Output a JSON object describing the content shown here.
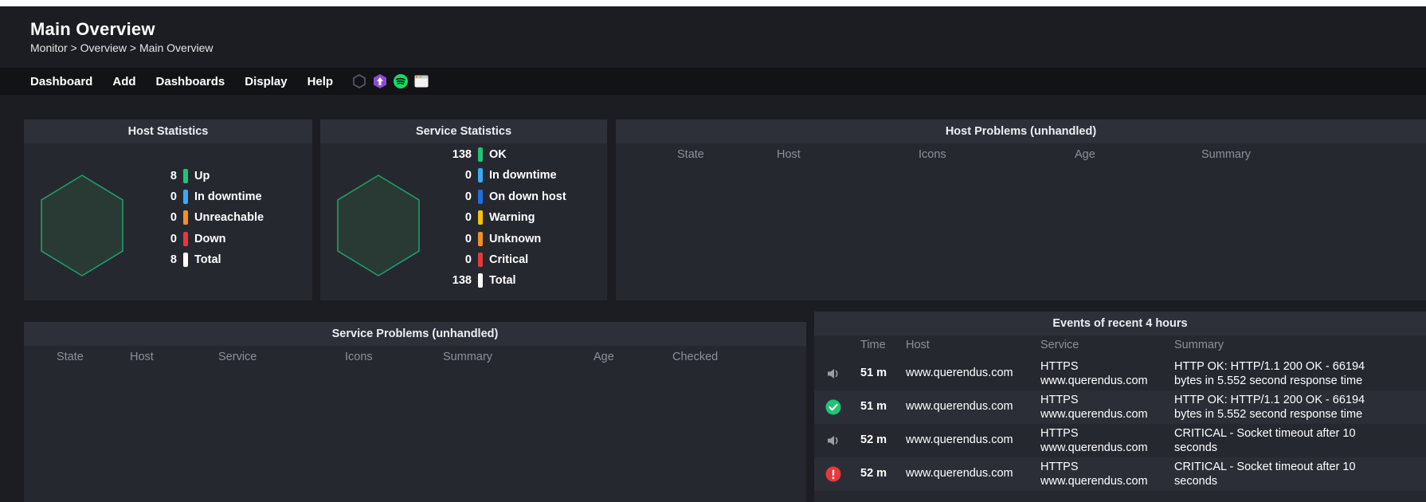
{
  "header": {
    "title": "Main Overview",
    "breadcrumb": "Monitor > Overview > Main Overview"
  },
  "menu": {
    "items": [
      "Dashboard",
      "Add",
      "Dashboards",
      "Display",
      "Help"
    ],
    "icons": [
      "hexagon-outline-icon",
      "upload-badge-icon",
      "spotify-icon",
      "window-icon"
    ]
  },
  "host_statistics": {
    "title": "Host Statistics",
    "rows": [
      {
        "count": "8",
        "label": "Up",
        "color": "#22c277"
      },
      {
        "count": "0",
        "label": "In downtime",
        "color": "#3aa9f4"
      },
      {
        "count": "0",
        "label": "Unreachable",
        "color": "#f0902a"
      },
      {
        "count": "0",
        "label": "Down",
        "color": "#e5393b"
      },
      {
        "count": "8",
        "label": "Total",
        "color": "#ffffff"
      }
    ]
  },
  "service_statistics": {
    "title": "Service Statistics",
    "rows": [
      {
        "count": "138",
        "label": "OK",
        "color": "#22c277"
      },
      {
        "count": "0",
        "label": "In downtime",
        "color": "#3aa9f4"
      },
      {
        "count": "0",
        "label": "On down host",
        "color": "#1e6fe0"
      },
      {
        "count": "0",
        "label": "Warning",
        "color": "#f4c20d"
      },
      {
        "count": "0",
        "label": "Unknown",
        "color": "#f0902a"
      },
      {
        "count": "0",
        "label": "Critical",
        "color": "#e5393b"
      },
      {
        "count": "138",
        "label": "Total",
        "color": "#ffffff"
      }
    ]
  },
  "host_problems": {
    "title": "Host Problems (unhandled)",
    "columns": [
      "State",
      "Host",
      "Icons",
      "Age",
      "Summary"
    ]
  },
  "service_problems": {
    "title": "Service Problems (unhandled)",
    "columns": [
      "State",
      "Host",
      "Service",
      "Icons",
      "Summary",
      "Age",
      "Checked"
    ]
  },
  "events": {
    "title": "Events of recent 4 hours",
    "columns": [
      "Time",
      "Host",
      "Service",
      "Summary"
    ],
    "rows": [
      {
        "icon": "speaker-icon",
        "time": "51 m",
        "host": "www.querendus.com",
        "service_1": "HTTPS",
        "service_2": "www.querendus.com",
        "summary_1": "HTTP OK: HTTP/1.1 200 OK - 66194",
        "summary_2": "bytes in 5.552 second response time"
      },
      {
        "icon": "ok-check-icon",
        "time": "51 m",
        "host": "www.querendus.com",
        "service_1": "HTTPS",
        "service_2": "www.querendus.com",
        "summary_1": "HTTP OK: HTTP/1.1 200 OK - 66194",
        "summary_2": "bytes in 5.552 second response time"
      },
      {
        "icon": "speaker-icon",
        "time": "52 m",
        "host": "www.querendus.com",
        "service_1": "HTTPS",
        "service_2": "www.querendus.com",
        "summary_1": "CRITICAL - Socket timeout after 10",
        "summary_2": "seconds"
      },
      {
        "icon": "critical-alert-icon",
        "time": "52 m",
        "host": "www.querendus.com",
        "service_1": "HTTPS",
        "service_2": "www.querendus.com",
        "summary_1": "CRITICAL - Socket timeout after 10",
        "summary_2": "seconds"
      }
    ]
  },
  "colors": {
    "background": "#1b1d23",
    "panel": "#262830",
    "panel_header": "#2d3039",
    "hexagon_stroke": "#1f9e6a",
    "ok": "#22c277",
    "critical": "#e5393b"
  }
}
